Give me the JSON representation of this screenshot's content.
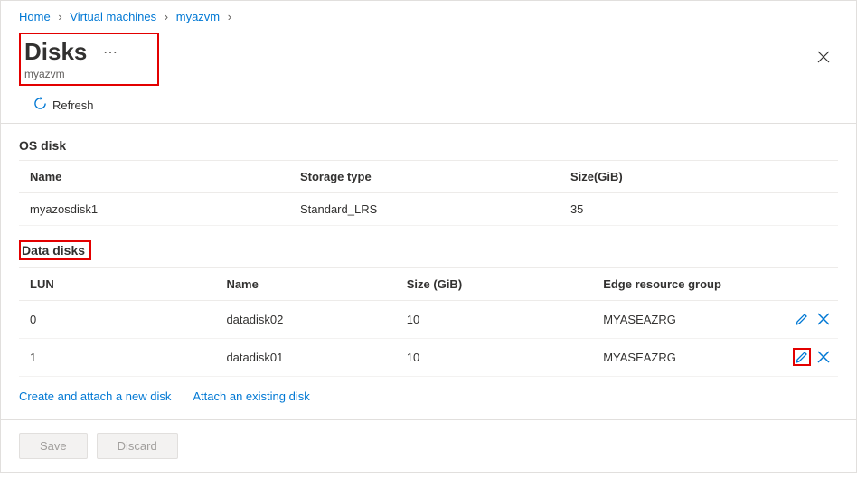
{
  "breadcrumb": {
    "home": "Home",
    "vms": "Virtual machines",
    "vm": "myazvm"
  },
  "header": {
    "title": "Disks",
    "subtitle": "myazvm"
  },
  "refresh": {
    "label": "Refresh"
  },
  "osdisk": {
    "title": "OS disk",
    "headers": {
      "name": "Name",
      "storage": "Storage type",
      "size": "Size(GiB)"
    },
    "row": {
      "name": "myazosdisk1",
      "storage": "Standard_LRS",
      "size": "35"
    }
  },
  "datadisks": {
    "title": "Data disks",
    "headers": {
      "lun": "LUN",
      "name": "Name",
      "size": "Size (GiB)",
      "rg": "Edge resource group"
    },
    "rows": [
      {
        "lun": "0",
        "name": "datadisk02",
        "size": "10",
        "rg": "MYASEAZRG"
      },
      {
        "lun": "1",
        "name": "datadisk01",
        "size": "10",
        "rg": "MYASEAZRG"
      }
    ]
  },
  "links": {
    "create": "Create and attach a new disk",
    "attach": "Attach an existing disk"
  },
  "footer": {
    "save": "Save",
    "discard": "Discard"
  }
}
